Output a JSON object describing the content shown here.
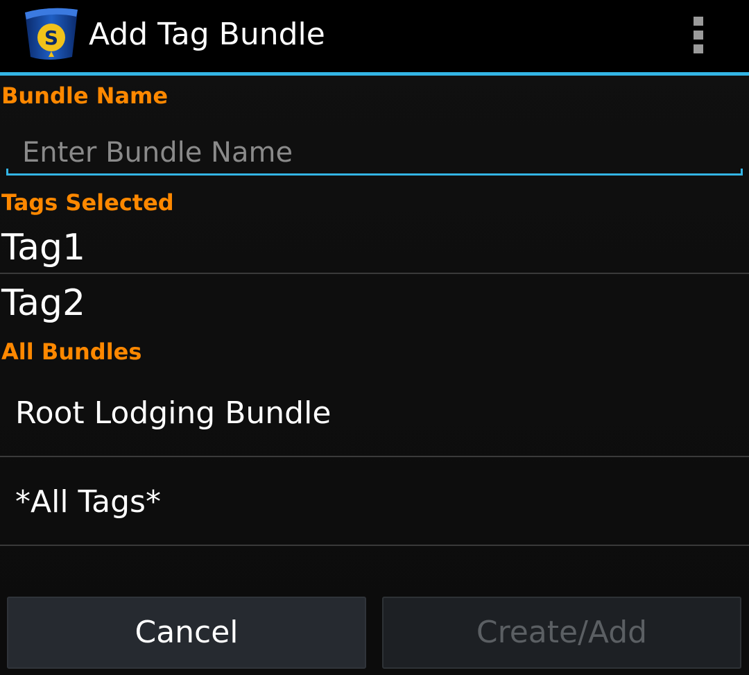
{
  "action_bar": {
    "title": "Add Tag Bundle",
    "app_icon": "sanction-logo-icon",
    "overflow_icon": "overflow-menu-icon",
    "accent_color": "#33b5e5"
  },
  "bundle_name": {
    "header": "Bundle Name",
    "value": "",
    "placeholder": "Enter Bundle Name"
  },
  "tags_selected": {
    "header": "Tags Selected",
    "items": [
      "Tag1",
      "Tag2"
    ]
  },
  "all_bundles": {
    "header": "All Bundles",
    "items": [
      "Root Lodging Bundle",
      "*All Tags*"
    ]
  },
  "buttons": {
    "cancel_label": "Cancel",
    "create_label": "Create/Add"
  },
  "colors": {
    "section_header": "#ff8800",
    "background": "#0d0d0d",
    "disabled_text": "#5b5f63"
  }
}
